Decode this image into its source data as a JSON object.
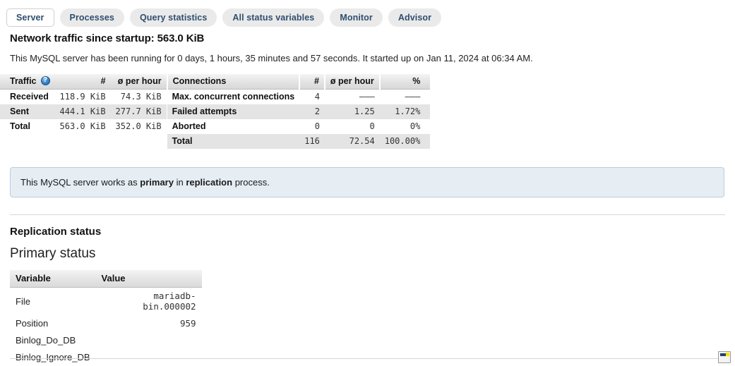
{
  "tabs": [
    {
      "label": "Server",
      "active": true
    },
    {
      "label": "Processes",
      "active": false
    },
    {
      "label": "Query statistics",
      "active": false
    },
    {
      "label": "All status variables",
      "active": false
    },
    {
      "label": "Monitor",
      "active": false
    },
    {
      "label": "Advisor",
      "active": false
    }
  ],
  "headings": {
    "network_traffic": "Network traffic since startup: 563.0 KiB",
    "uptime": "This MySQL server has been running for 0 days, 1 hours, 35 minutes and 57 seconds. It started up on Jan 11, 2024 at 06:34 AM.",
    "replication_status": "Replication status",
    "primary_status": "Primary status"
  },
  "traffic_table": {
    "headers": [
      "Traffic",
      "#",
      "ø per hour"
    ],
    "help_icon": "help-circle-icon",
    "rows": [
      {
        "label": "Received",
        "count": "118.9 KiB",
        "per_hour": "74.3 KiB"
      },
      {
        "label": "Sent",
        "count": "444.1 KiB",
        "per_hour": "277.7 KiB"
      },
      {
        "label": "Total",
        "count": "563.0 KiB",
        "per_hour": "352.0 KiB"
      },
      {
        "label": "",
        "count": "",
        "per_hour": ""
      }
    ]
  },
  "connections_table": {
    "headers": [
      "Connections",
      "#",
      "ø per hour",
      "%"
    ],
    "rows": [
      {
        "label": "Max. concurrent connections",
        "count": "4",
        "per_hour": "———",
        "percent": "———"
      },
      {
        "label": "Failed attempts",
        "count": "2",
        "per_hour": "1.25",
        "percent": "1.72%"
      },
      {
        "label": "Aborted",
        "count": "0",
        "per_hour": "0",
        "percent": "0%"
      },
      {
        "label": "Total",
        "count": "116",
        "per_hour": "72.54",
        "percent": "100.00%"
      }
    ]
  },
  "notice": {
    "text_before": "This MySQL server works as ",
    "bold_1": "primary",
    "text_middle": " in ",
    "bold_2": "replication",
    "text_after": " process."
  },
  "primary_status_table": {
    "headers": [
      "Variable",
      "Value"
    ],
    "rows": [
      {
        "variable": "File",
        "value": "mariadb-bin.000002"
      },
      {
        "variable": "Position",
        "value": "959"
      },
      {
        "variable": "Binlog_Do_DB",
        "value": ""
      },
      {
        "variable": "Binlog_Ignore_DB",
        "value": ""
      }
    ]
  },
  "footer": {
    "console_icon": "console-window-icon"
  },
  "colors": {
    "tab_text": "#2e4f6e",
    "tab_bg": "#eaeaea",
    "notice_bg": "#e6eef4",
    "notice_border": "#b8cedd",
    "row_stripe": "#e4e4e4"
  }
}
